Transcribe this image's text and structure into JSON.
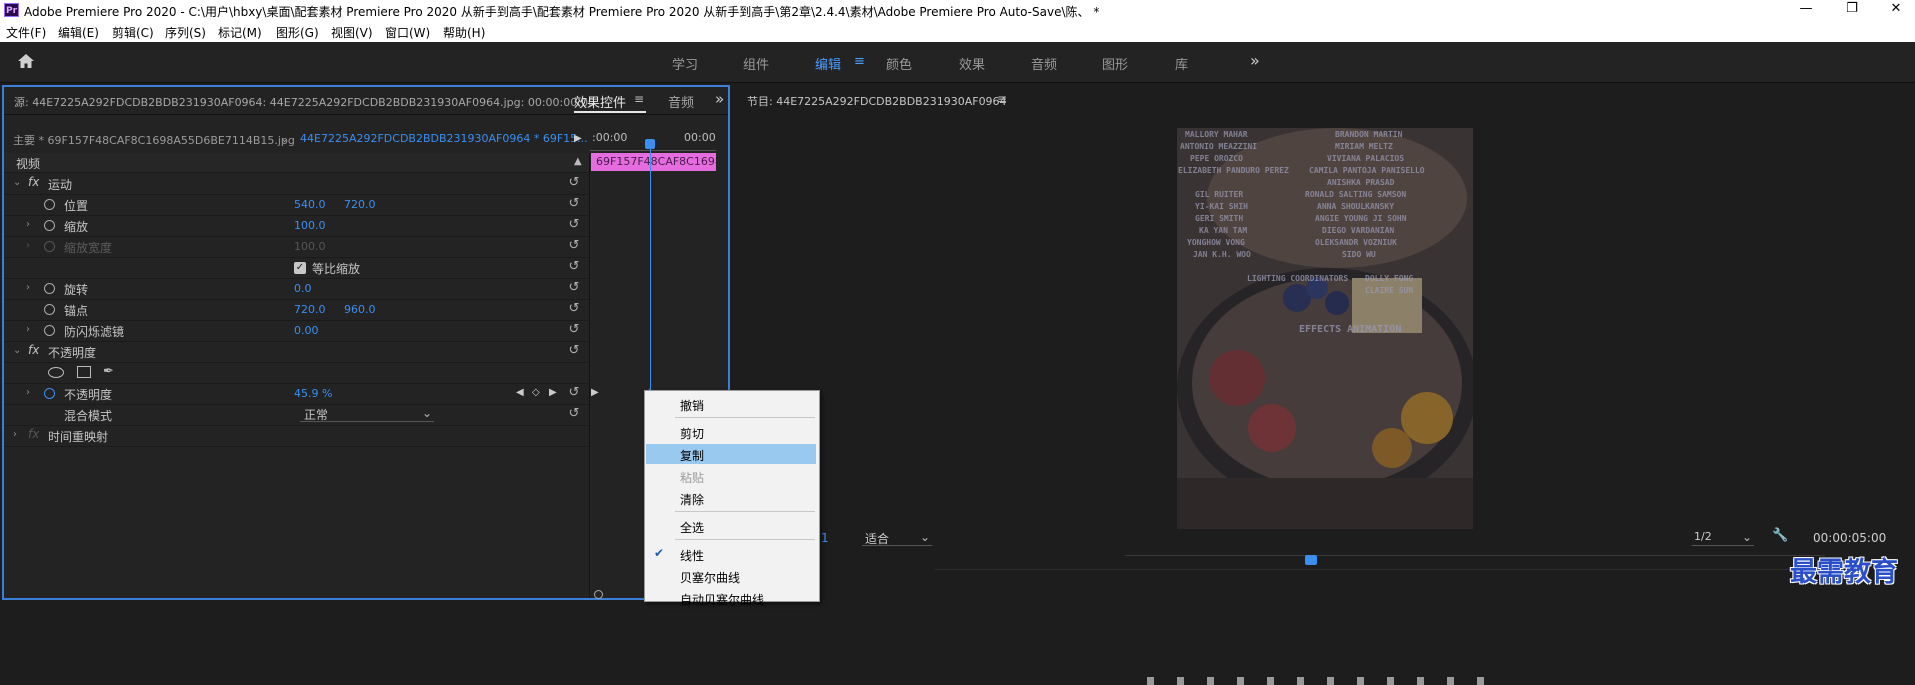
{
  "window": {
    "title": "Adobe Premiere Pro 2020 - C:\\用户\\hbxy\\桌面\\配套素材 Premiere Pro 2020 从新手到高手\\配套素材 Premiere Pro 2020 从新手到高手\\第2章\\2.4.4\\素材\\Adobe Premiere Pro Auto-Save\\陈、 *",
    "logo": "Pr",
    "minimize": "—",
    "restore": "❐",
    "close": "✕"
  },
  "menu": [
    "文件(F)",
    "编辑(E)",
    "剪辑(C)",
    "序列(S)",
    "标记(M)",
    "图形(G)",
    "视图(V)",
    "窗口(W)",
    "帮助(H)"
  ],
  "workspaces": {
    "items": [
      "学习",
      "组件",
      "编辑",
      "颜色",
      "效果",
      "音频",
      "图形",
      "库"
    ],
    "active": "编辑",
    "more": "»",
    "menu_icon": "≡"
  },
  "effect_controls": {
    "source_label": "源: 44E7225A292FDCDB2BDB231930AF0964: 44E7225A292FDCDB2BDB231930AF0964.jpg: 00:00:00:00",
    "tab_effect_controls": "效果控件",
    "tab_audio": "音频",
    "tab_menu_icon": "≡",
    "more": "»",
    "master_label": "主要 * 69F157F48CAF8C1698A55D6BE7114B15.jpg",
    "sequence_label": "44E7225A292FDCDB2BDB231930AF0964 * 69F15...",
    "video_header": "视频",
    "timecode_left": ":00:00",
    "timecode_right": "00:00",
    "clip_bar_label": "69F157F48CAF8C1698A",
    "motion": {
      "fx": "fx",
      "name": "运动",
      "position_label": "位置",
      "position_x": "540.0",
      "position_y": "720.0",
      "scale_label": "缩放",
      "scale_value": "100.0",
      "scale_width_label": "缩放宽度",
      "scale_width_value": "100.0",
      "uniform_scale_label": "等比缩放",
      "rotation_label": "旋转",
      "rotation_value": "0.0",
      "anchor_label": "锚点",
      "anchor_x": "720.0",
      "anchor_y": "960.0",
      "flicker_label": "防闪烁滤镜",
      "flicker_value": "0.00"
    },
    "opacity": {
      "fx": "fx",
      "name": "不透明度",
      "opacity_label": "不透明度",
      "opacity_value": "45.9 %",
      "blend_label": "混合模式",
      "blend_value": "正常"
    },
    "time_remap": {
      "fx": "fx",
      "name": "时间重映射"
    }
  },
  "program": {
    "title": "节目: 44E7225A292FDCDB2BDB231930AF0964",
    "menu_icon": "≡",
    "fit_label": "适合",
    "fraction_label": "1/2",
    "timecode": "00:00:05:00",
    "partial_left_timecode": "1",
    "preview_text": [
      "MALLORY MAHAR",
      "BRANDON MARTIN",
      "ANTONIO MEAZZINI",
      "MIRIAM MELTZ",
      "PEPE OROZCO",
      "VIVIANA PALACIOS",
      "ELIZABETH PANDURO PEREZ",
      "CAMILA PANTOJA PANISELLO",
      "ANISHKA PRASAD",
      "GIL RUITER",
      "RONALD SALTING SAMSON",
      "YI-KAI SHIH",
      "ANNA SHOULKANSKY",
      "GERI SMITH",
      "ANGIE YOUNG JI SOHN",
      "KA YAN TAM",
      "DIEGO VARDANIAN",
      "YONGHOW VONG",
      "OLEKSANDR VOZNIUK",
      "JAN K.H. WOO",
      "SIDO WU",
      "LIGHTING COORDINATORS",
      "DOLLY FONG",
      "CLAIRE SUN",
      "EFFECTS ANIMATION"
    ]
  },
  "context_menu": {
    "items": [
      {
        "label": "撤销",
        "state": "normal"
      },
      {
        "label": "剪切",
        "state": "normal"
      },
      {
        "label": "复制",
        "state": "highlighted"
      },
      {
        "label": "粘贴",
        "state": "disabled"
      },
      {
        "label": "清除",
        "state": "normal"
      },
      {
        "label": "全选",
        "state": "normal"
      },
      {
        "label": "线性",
        "state": "checked"
      },
      {
        "label": "贝塞尔曲线",
        "state": "normal"
      },
      {
        "label": "自动贝塞尔曲线",
        "state": "normal"
      }
    ],
    "check_mark": "✔"
  },
  "watermark": "最需教育",
  "colors": {
    "accent": "#3a8ff0",
    "clip_bar": "#e66de0",
    "highlight": "#99c9ef"
  }
}
